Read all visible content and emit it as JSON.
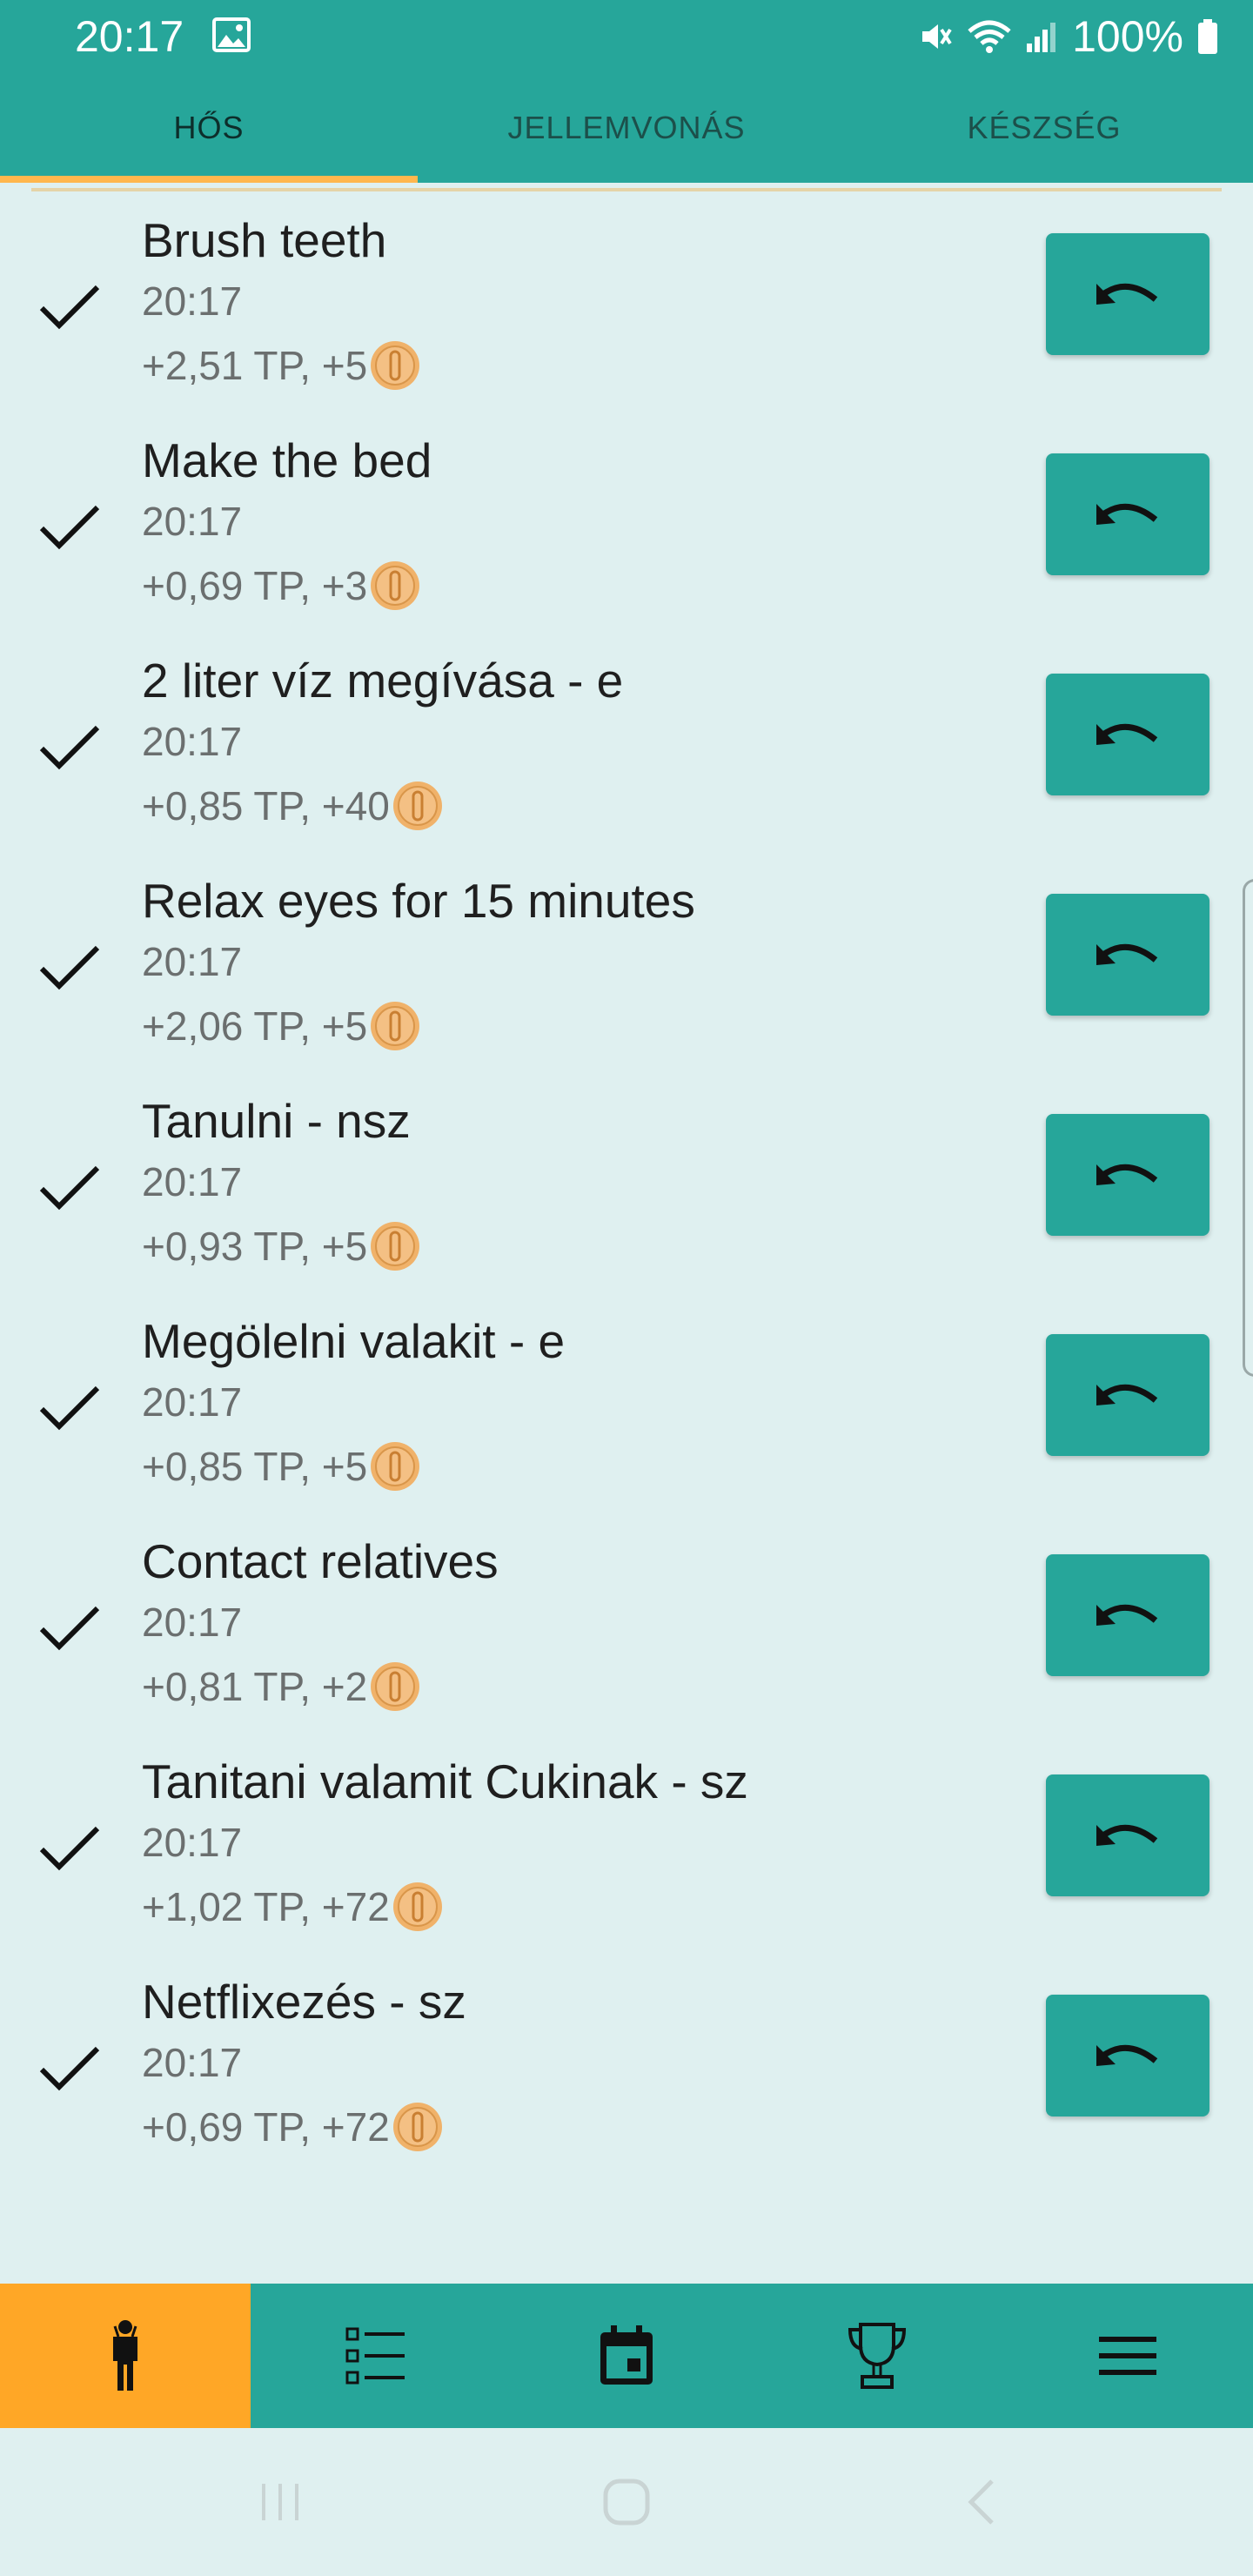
{
  "status_bar": {
    "time": "20:17",
    "battery_text": "100%",
    "icons": [
      "gallery-icon",
      "mute-icon",
      "wifi-icon",
      "signal-icon",
      "battery-icon"
    ]
  },
  "tabs": [
    {
      "label": "HŐS",
      "active": true
    },
    {
      "label": "JELLEMVONÁS",
      "active": false
    },
    {
      "label": "KÉSZSÉG",
      "active": false
    }
  ],
  "items": [
    {
      "title": "Brush teeth",
      "time": "20:17",
      "reward": "+2,51 TP, +5"
    },
    {
      "title": "Make the bed",
      "time": "20:17",
      "reward": "+0,69 TP, +3"
    },
    {
      "title": "2 liter víz megívása - e",
      "time": "20:17",
      "reward": "+0,85 TP, +40"
    },
    {
      "title": "Relax eyes for 15 minutes",
      "time": "20:17",
      "reward": "+2,06 TP, +5"
    },
    {
      "title": "Tanulni - nsz",
      "time": "20:17",
      "reward": "+0,93 TP, +5"
    },
    {
      "title": "Megölelni valakit - e",
      "time": "20:17",
      "reward": "+0,85 TP, +5"
    },
    {
      "title": "Contact relatives",
      "time": "20:17",
      "reward": "+0,81 TP, +2"
    },
    {
      "title": "Tanitani valamit Cukinak - sz",
      "time": "20:17",
      "reward": "+1,02 TP, +72"
    },
    {
      "title": "Netflixezés - sz",
      "time": "20:17",
      "reward": "+0,69 TP, +72"
    }
  ],
  "bottom_nav": [
    {
      "icon": "hero-icon",
      "active": true
    },
    {
      "icon": "task-list-icon",
      "active": false
    },
    {
      "icon": "calendar-icon",
      "active": false
    },
    {
      "icon": "trophy-icon",
      "active": false
    },
    {
      "icon": "menu-icon",
      "active": false
    }
  ],
  "system_nav": [
    "recent-apps-icon",
    "home-icon",
    "back-icon"
  ],
  "colors": {
    "primary": "#26a69a",
    "accent": "#ffa726",
    "background": "#dff0f0",
    "coin": "#f0b26a"
  }
}
